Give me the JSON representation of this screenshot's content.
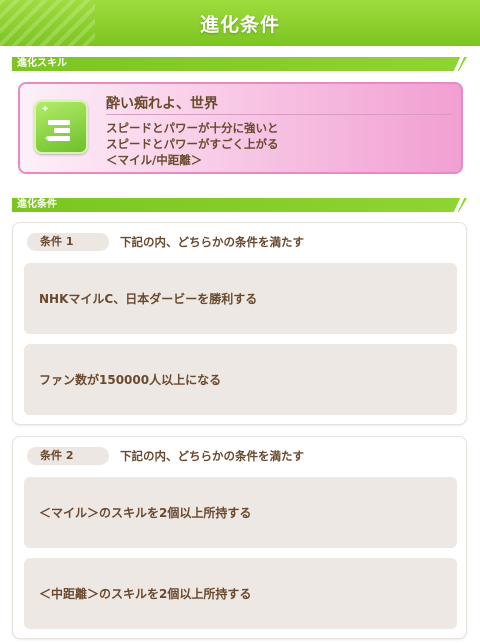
{
  "header": {
    "title": "進化条件"
  },
  "skill_section": {
    "label": "進化スキル"
  },
  "skill": {
    "icon": "skill-up-icon",
    "name": "酔い痴れよ、世界",
    "description": "スピードとパワーが十分に強いと\nスピードとパワーがすごく上がる\n＜マイル/中距離＞"
  },
  "condition_section": {
    "label": "進化条件"
  },
  "conditions": [
    {
      "badge": "条件 1",
      "title": "下記の内、どちらかの条件を満たす",
      "requirements": [
        "NHKマイルC、日本ダービーを勝利する",
        "ファン数が150000人以上になる"
      ]
    },
    {
      "badge": "条件 2",
      "title": "下記の内、どちらかの条件を満たす",
      "requirements": [
        "＜マイル＞のスキルを2個以上所持する",
        "＜中距離＞のスキルを2個以上所持する"
      ]
    }
  ],
  "colors": {
    "header_green": "#7cc520",
    "skill_pink": "#f19fd2",
    "text_brown": "#6a4a2e"
  }
}
